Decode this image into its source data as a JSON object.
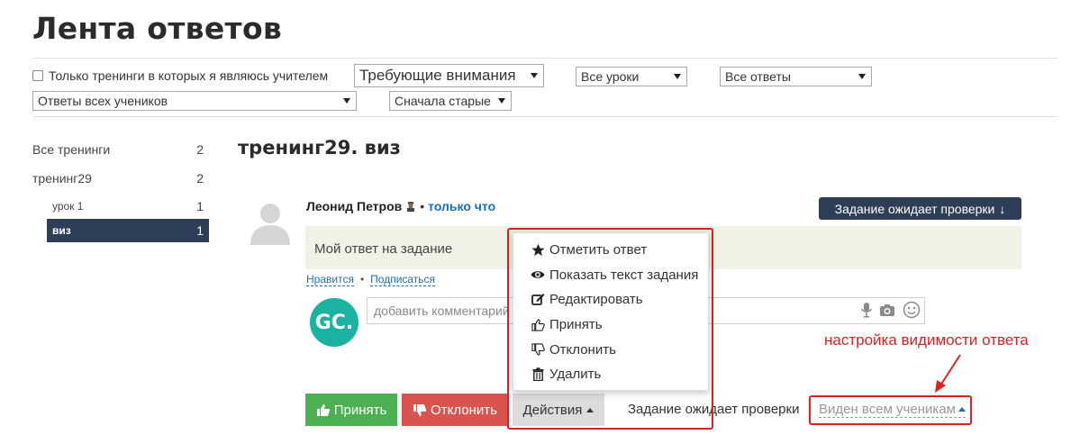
{
  "page": {
    "title": "Лента ответов"
  },
  "filters": {
    "only_teacher_label": "Только тренинги в которых я являюсь учителем",
    "attention_select": "Требующие внимания",
    "lessons_select": "Все уроки",
    "answers_select": "Все ответы",
    "students_select": "Ответы всех учеников",
    "sort_select": "Сначала старые"
  },
  "sidebar": {
    "items": [
      {
        "label": "Все тренинги",
        "count": "2"
      },
      {
        "label": "тренинг29",
        "count": "2"
      },
      {
        "label": "урок 1",
        "count": "1"
      },
      {
        "label": "виз",
        "count": "1"
      }
    ]
  },
  "section": {
    "title": "тренинг29. виз"
  },
  "answer": {
    "author": "Леонид Петров",
    "separator": "•",
    "time": "только что",
    "status_button": "Задание ожидает проверки",
    "text": "Мой ответ на задание",
    "like_link": "Нравится",
    "link_separator": "•",
    "subscribe_link": "Подписаться"
  },
  "comment": {
    "avatar_text": "GC.",
    "placeholder": "добавить комментарий"
  },
  "actions_menu": {
    "items": [
      {
        "label": "Отметить ответ",
        "icon": "star-icon"
      },
      {
        "label": "Показать текст задания",
        "icon": "eye-icon"
      },
      {
        "label": "Редактировать",
        "icon": "edit-icon"
      },
      {
        "label": "Принять",
        "icon": "thumbs-up-icon"
      },
      {
        "label": "Отклонить",
        "icon": "thumbs-down-icon"
      },
      {
        "label": "Удалить",
        "icon": "trash-icon"
      }
    ]
  },
  "buttons": {
    "accept": "Принять",
    "reject": "Отклонить",
    "actions": "Действия"
  },
  "status_text": "Задание ожидает проверки",
  "visibility": "Виден всем ученикам",
  "annotation": "настройка видимости ответа",
  "colors": {
    "accent_dark": "#2e3e56",
    "accept_green": "#4cb052",
    "reject_red": "#d9534f",
    "annotation_red": "#e02020",
    "link_blue": "#1a6fb5"
  }
}
